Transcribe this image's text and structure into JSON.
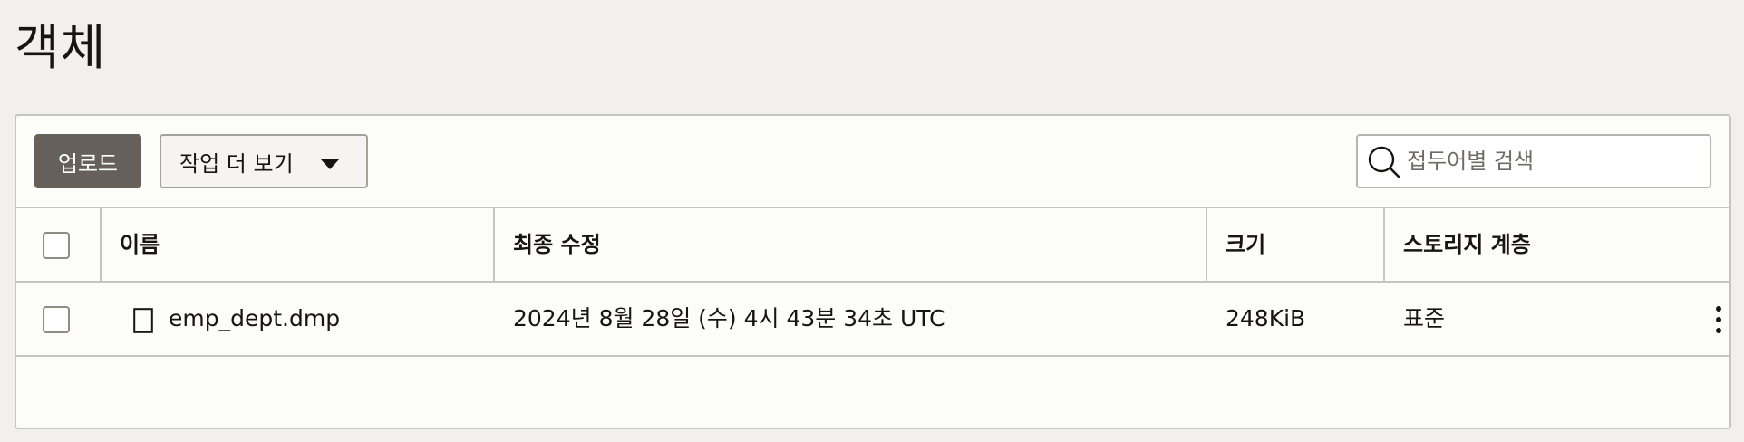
{
  "page": {
    "title": "객체"
  },
  "toolbar": {
    "upload_label": "업로드",
    "more_actions_label": "작업 더 보기",
    "search_placeholder": "접두어별 검색"
  },
  "table": {
    "columns": {
      "name": "이름",
      "last_modified": "최종 수정",
      "size": "크기",
      "storage_tier": "스토리지 계층"
    },
    "rows": [
      {
        "name": "emp_dept.dmp",
        "last_modified": "2024년 8월 28일 (수) 4시 43분 34초 UTC",
        "size": "248KiB",
        "storage_tier": "표준"
      }
    ]
  },
  "icons": {
    "search": "search-icon",
    "dropdown": "caret-down-icon",
    "file": "file-icon",
    "row_actions": "kebab-menu-icon"
  },
  "colors": {
    "primary_button": "#65605a",
    "border": "#c6c4c1",
    "page_background": "#f1f0ee"
  }
}
